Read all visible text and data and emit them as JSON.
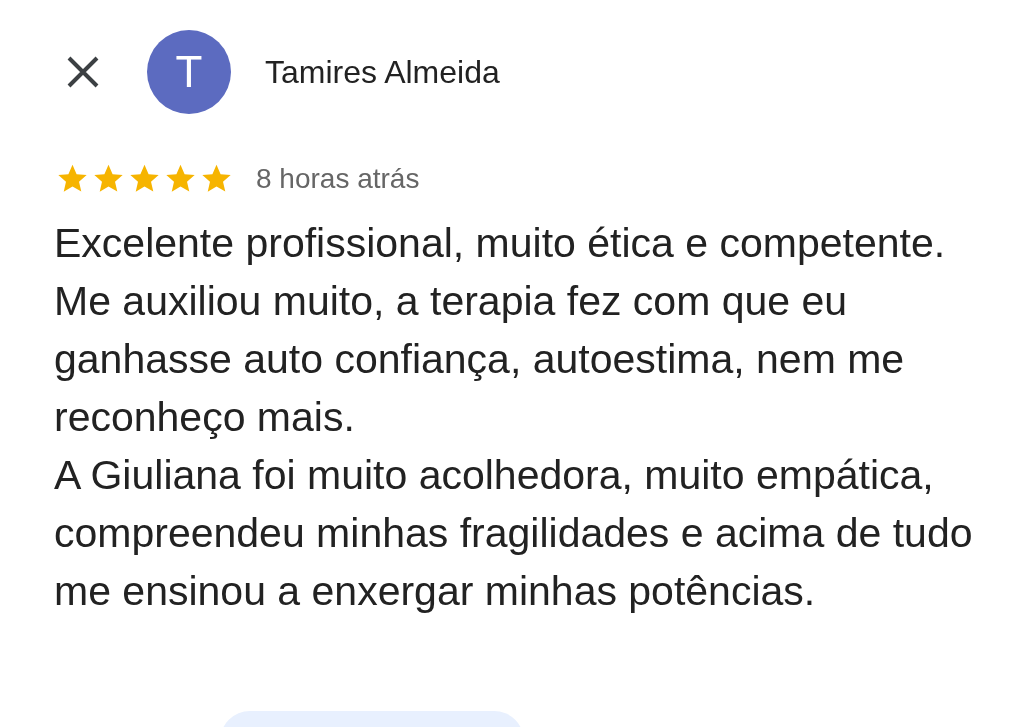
{
  "reviewer": {
    "name": "Tamires Almeida",
    "initial": "T"
  },
  "review": {
    "stars": 5,
    "time": "8 horas atrás",
    "paragraphs": [
      "Excelente profissional, muito ética e competente.",
      "Me auxiliou muito, a terapia fez com que eu ganhasse auto confiança, autoestima,  nem me reconheço mais.",
      "A Giuliana foi muito acolhedora, muito empática, compreendeu minhas fragilidades e acima de tudo me ensinou a enxergar minhas potências."
    ]
  }
}
